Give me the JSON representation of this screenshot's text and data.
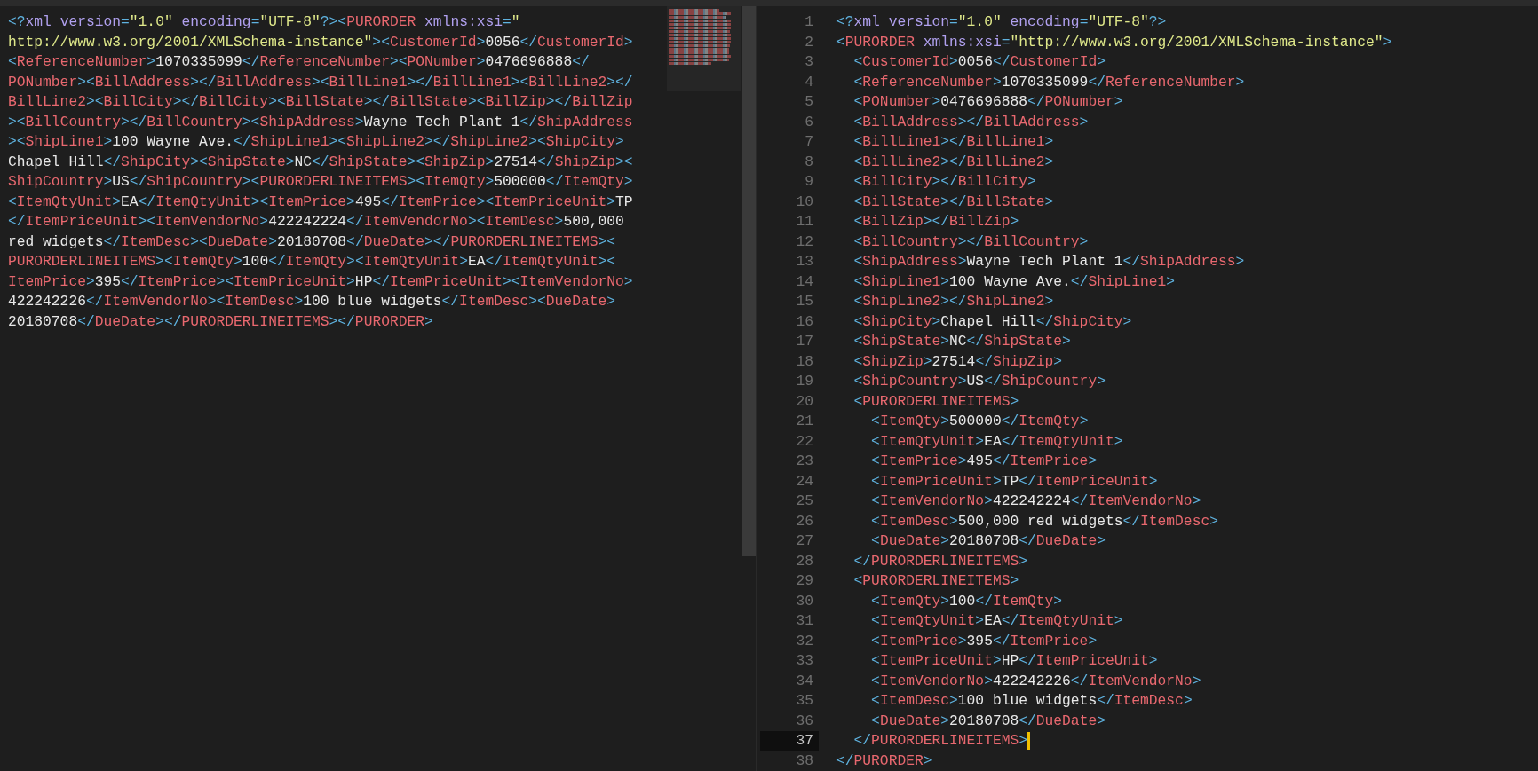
{
  "left_editor": {
    "lines": [
      "<?xml version=\"1.0\" encoding=\"UTF-8\"?><PURORDER xmlns:xsi=\"",
      "http://www.w3.org/2001/XMLSchema-instance\"><CustomerId>0056</CustomerId>",
      "<ReferenceNumber>1070335099</ReferenceNumber><PONumber>0476696888</",
      "PONumber><BillAddress></BillAddress><BillLine1></BillLine1><BillLine2></",
      "BillLine2><BillCity></BillCity><BillState></BillState><BillZip></BillZip",
      "><BillCountry></BillCountry><ShipAddress>Wayne Tech Plant 1</ShipAddress",
      "><ShipLine1>100 Wayne Ave.</ShipLine1><ShipLine2></ShipLine2><ShipCity>",
      "Chapel Hill</ShipCity><ShipState>NC</ShipState><ShipZip>27514</ShipZip><",
      "ShipCountry>US</ShipCountry><PURORDERLINEITEMS><ItemQty>500000</ItemQty>",
      "<ItemQtyUnit>EA</ItemQtyUnit><ItemPrice>495</ItemPrice><ItemPriceUnit>TP",
      "</ItemPriceUnit><ItemVendorNo>422242224</ItemVendorNo><ItemDesc>500,000",
      "red widgets</ItemDesc><DueDate>20180708</DueDate></PURORDERLINEITEMS><",
      "PURORDERLINEITEMS><ItemQty>100</ItemQty><ItemQtyUnit>EA</ItemQtyUnit><",
      "ItemPrice>395</ItemPrice><ItemPriceUnit>HP</ItemPriceUnit><ItemVendorNo>",
      "422242226</ItemVendorNo><ItemDesc>100 blue widgets</ItemDesc><DueDate>",
      "20180708</DueDate></PURORDERLINEITEMS></PURORDER>"
    ]
  },
  "right_editor": {
    "lines": [
      {
        "number": "1",
        "text": "<?xml version=\"1.0\" encoding=\"UTF-8\"?>",
        "current": false
      },
      {
        "number": "2",
        "text": "<PURORDER xmlns:xsi=\"http://www.w3.org/2001/XMLSchema-instance\">",
        "current": false
      },
      {
        "number": "3",
        "text": "  <CustomerId>0056</CustomerId>",
        "current": false
      },
      {
        "number": "4",
        "text": "  <ReferenceNumber>1070335099</ReferenceNumber>",
        "current": false
      },
      {
        "number": "5",
        "text": "  <PONumber>0476696888</PONumber>",
        "current": false
      },
      {
        "number": "6",
        "text": "  <BillAddress></BillAddress>",
        "current": false
      },
      {
        "number": "7",
        "text": "  <BillLine1></BillLine1>",
        "current": false
      },
      {
        "number": "8",
        "text": "  <BillLine2></BillLine2>",
        "current": false
      },
      {
        "number": "9",
        "text": "  <BillCity></BillCity>",
        "current": false
      },
      {
        "number": "10",
        "text": "  <BillState></BillState>",
        "current": false
      },
      {
        "number": "11",
        "text": "  <BillZip></BillZip>",
        "current": false
      },
      {
        "number": "12",
        "text": "  <BillCountry></BillCountry>",
        "current": false
      },
      {
        "number": "13",
        "text": "  <ShipAddress>Wayne Tech Plant 1</ShipAddress>",
        "current": false
      },
      {
        "number": "14",
        "text": "  <ShipLine1>100 Wayne Ave.</ShipLine1>",
        "current": false
      },
      {
        "number": "15",
        "text": "  <ShipLine2></ShipLine2>",
        "current": false
      },
      {
        "number": "16",
        "text": "  <ShipCity>Chapel Hill</ShipCity>",
        "current": false
      },
      {
        "number": "17",
        "text": "  <ShipState>NC</ShipState>",
        "current": false
      },
      {
        "number": "18",
        "text": "  <ShipZip>27514</ShipZip>",
        "current": false
      },
      {
        "number": "19",
        "text": "  <ShipCountry>US</ShipCountry>",
        "current": false
      },
      {
        "number": "20",
        "text": "  <PURORDERLINEITEMS>",
        "current": false
      },
      {
        "number": "21",
        "text": "    <ItemQty>500000</ItemQty>",
        "current": false
      },
      {
        "number": "22",
        "text": "    <ItemQtyUnit>EA</ItemQtyUnit>",
        "current": false
      },
      {
        "number": "23",
        "text": "    <ItemPrice>495</ItemPrice>",
        "current": false
      },
      {
        "number": "24",
        "text": "    <ItemPriceUnit>TP</ItemPriceUnit>",
        "current": false
      },
      {
        "number": "25",
        "text": "    <ItemVendorNo>422242224</ItemVendorNo>",
        "current": false
      },
      {
        "number": "26",
        "text": "    <ItemDesc>500,000 red widgets</ItemDesc>",
        "current": false
      },
      {
        "number": "27",
        "text": "    <DueDate>20180708</DueDate>",
        "current": false
      },
      {
        "number": "28",
        "text": "  </PURORDERLINEITEMS>",
        "current": false
      },
      {
        "number": "29",
        "text": "  <PURORDERLINEITEMS>",
        "current": false
      },
      {
        "number": "30",
        "text": "    <ItemQty>100</ItemQty>",
        "current": false
      },
      {
        "number": "31",
        "text": "    <ItemQtyUnit>EA</ItemQtyUnit>",
        "current": false
      },
      {
        "number": "32",
        "text": "    <ItemPrice>395</ItemPrice>",
        "current": false
      },
      {
        "number": "33",
        "text": "    <ItemPriceUnit>HP</ItemPriceUnit>",
        "current": false
      },
      {
        "number": "34",
        "text": "    <ItemVendorNo>422242226</ItemVendorNo>",
        "current": false
      },
      {
        "number": "35",
        "text": "    <ItemDesc>100 blue widgets</ItemDesc>",
        "current": false
      },
      {
        "number": "36",
        "text": "    <DueDate>20180708</DueDate>",
        "current": false
      },
      {
        "number": "37",
        "text": "  </PURORDERLINEITEMS>",
        "current": true
      },
      {
        "number": "38",
        "text": "</PURORDER>",
        "current": false
      }
    ]
  }
}
